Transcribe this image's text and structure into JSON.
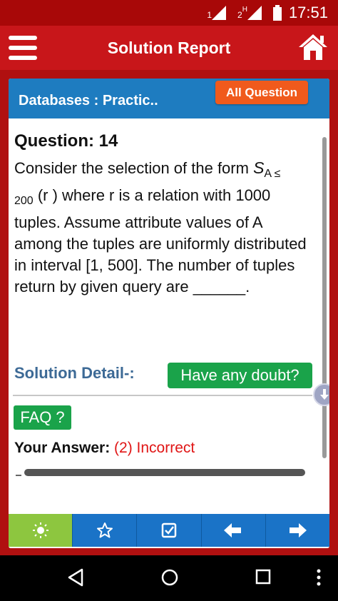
{
  "status_bar": {
    "sim1": "1",
    "sim2": "2",
    "network": "H",
    "time": "17:51"
  },
  "app_bar": {
    "title": "Solution Report"
  },
  "card": {
    "subject": "Databases : Practic..",
    "all_question_label": "All Question",
    "question_title": "Question: 14",
    "question_text_1": "Consider the selection of the form ",
    "question_symbol": "S",
    "question_subscript_1": "A ≤",
    "question_subscript_2": "200",
    "question_text_2": " (r ) where r is a relation with 1000 tuples. Assume attribute values of A among the tuples are uniformly distributed in interval [1, 500]. The number of tuples return by given query are ______.",
    "solution_label": "Solution Detail-:",
    "doubt_label": "Have any doubt?",
    "faq_label": "FAQ ?",
    "answer_label": "Your Answer:",
    "answer_value": "(2) Incorrect"
  },
  "toolbar": {
    "items": [
      {
        "icon": "brightness-icon",
        "active": true
      },
      {
        "icon": "star-icon",
        "active": false
      },
      {
        "icon": "checkbox-icon",
        "active": false
      },
      {
        "icon": "arrow-left-icon",
        "active": false
      },
      {
        "icon": "arrow-right-icon",
        "active": false
      }
    ]
  },
  "colors": {
    "app_bar": "#c8161a",
    "card_header": "#1e7cc0",
    "accent_orange": "#f05a1c",
    "green": "#1aa34a",
    "incorrect": "#e01515"
  }
}
